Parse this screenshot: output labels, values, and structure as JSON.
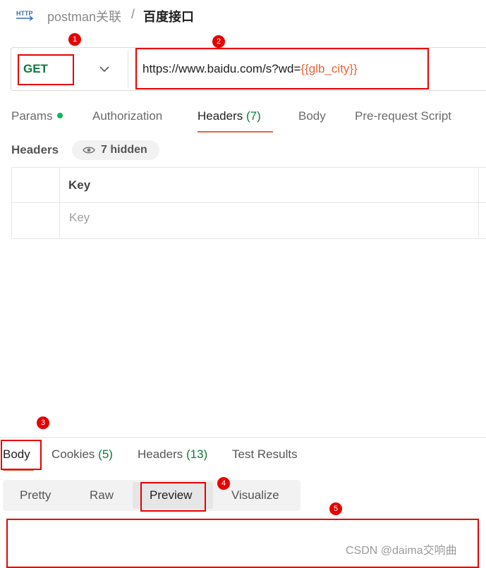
{
  "breadcrumb": {
    "parent": "postman关联",
    "separator": "/",
    "current": "百度接口",
    "icon": "http-icon"
  },
  "request": {
    "method": "GET",
    "url_prefix": "https://www.baidu.com/s?wd=",
    "url_variable": "{{glb_city}}"
  },
  "request_tabs": [
    {
      "label": "Params",
      "dot": true
    },
    {
      "label": "Authorization"
    },
    {
      "label": "Headers",
      "count": "(7)",
      "active": true
    },
    {
      "label": "Body"
    },
    {
      "label": "Pre-request Script"
    }
  ],
  "headers_section": {
    "title": "Headers",
    "hidden": "7 hidden",
    "table": {
      "column": "Key",
      "placeholder": "Key"
    }
  },
  "response_tabs": [
    {
      "label": "Body",
      "active": true
    },
    {
      "label": "Cookies",
      "count": "(5)"
    },
    {
      "label": "Headers",
      "count": "(13)"
    },
    {
      "label": "Test Results"
    }
  ],
  "view_modes": [
    {
      "label": "Pretty"
    },
    {
      "label": "Raw"
    },
    {
      "label": "Preview",
      "active": true
    },
    {
      "label": "Visualize"
    }
  ],
  "annotations": [
    "1",
    "2",
    "3",
    "4",
    "5"
  ],
  "watermark": "CSDN @daima交响曲",
  "colors": {
    "method_green": "#0b7b3e",
    "variable_orange": "#e8623a",
    "annotation_red": "#e60000",
    "active_underline": "#e8623a"
  }
}
